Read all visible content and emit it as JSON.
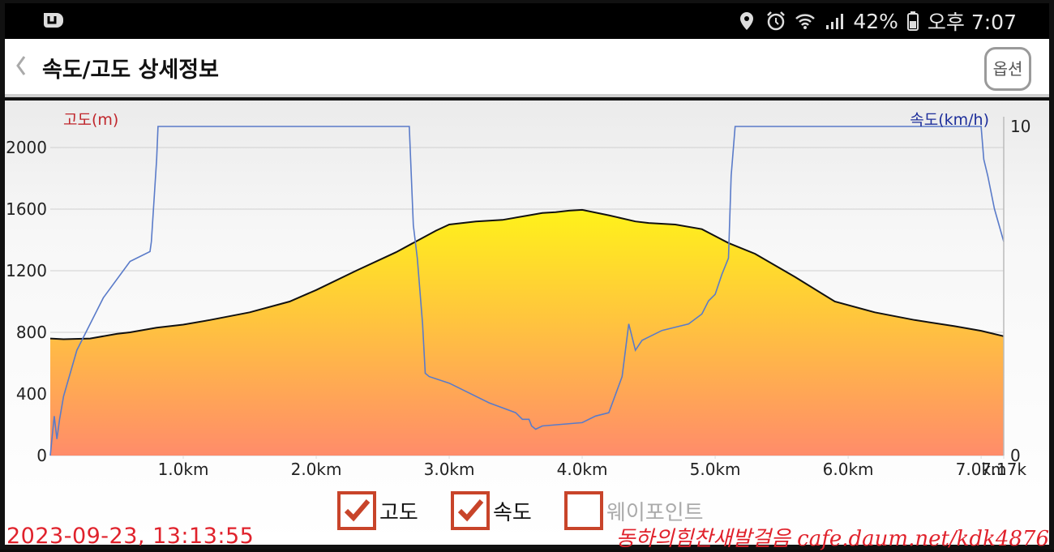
{
  "status_bar": {
    "battery": "42%",
    "time": "오후 7:07",
    "icons": [
      "location-icon",
      "alarm-icon",
      "wifi-icon",
      "signal-icon",
      "battery-icon"
    ]
  },
  "header": {
    "title": "속도/고도 상세정보",
    "options_label": "옵션"
  },
  "legend": {
    "altitude": "고도",
    "speed": "속도",
    "waypoint": "웨이포인트"
  },
  "footer": {
    "timestamp": "2023-09-23, 13:13:55",
    "watermark": "동하의힘찬새발걸음 cafe.daum.net/kdk4876"
  },
  "colors": {
    "altitude_line": "#111111",
    "speed_line": "#5a7bc9",
    "fill_top": "#fff21a",
    "fill_bottom": "#ff8c6a",
    "accent": "#c8442a"
  },
  "chart_data": {
    "type": "area",
    "left_axis_label": "고도(m)",
    "right_axis_label": "속도(km/h)",
    "x_ticks": [
      "1.0km",
      "2.0km",
      "3.0km",
      "4.0km",
      "5.0km",
      "6.0km",
      "7.0km",
      "7.17k"
    ],
    "y_ticks": [
      "0",
      "400",
      "800",
      "1200",
      "1600",
      "2000"
    ],
    "right_ticks": [
      "0",
      "10"
    ],
    "xlim": [
      0,
      7.17
    ],
    "ylim": [
      0,
      2200
    ],
    "y2lim": [
      0,
      10
    ],
    "series": [
      {
        "name": "고도",
        "axis": "left",
        "x": [
          0,
          0.1,
          0.3,
          0.5,
          0.6,
          0.8,
          1.0,
          1.2,
          1.5,
          1.8,
          2.0,
          2.3,
          2.6,
          2.9,
          3.0,
          3.2,
          3.4,
          3.6,
          3.7,
          3.8,
          3.9,
          4.0,
          4.2,
          4.4,
          4.5,
          4.7,
          4.9,
          5.1,
          5.3,
          5.6,
          5.9,
          6.2,
          6.5,
          6.8,
          7.0,
          7.17
        ],
        "y": [
          760,
          755,
          760,
          790,
          800,
          830,
          850,
          880,
          930,
          1000,
          1075,
          1200,
          1320,
          1460,
          1500,
          1520,
          1530,
          1560,
          1575,
          1580,
          1590,
          1595,
          1560,
          1520,
          1510,
          1500,
          1470,
          1380,
          1310,
          1160,
          1000,
          930,
          880,
          840,
          810,
          775
        ]
      },
      {
        "name": "속도",
        "axis": "right",
        "x": [
          0,
          0.03,
          0.05,
          0.07,
          0.1,
          0.2,
          0.4,
          0.6,
          0.75,
          0.76,
          0.8,
          0.81,
          2.7,
          2.73,
          2.76,
          2.8,
          2.82,
          2.85,
          3.0,
          3.3,
          3.5,
          3.55,
          3.6,
          3.62,
          3.65,
          3.7,
          4.0,
          4.1,
          4.2,
          4.3,
          4.35,
          4.4,
          4.45,
          4.5,
          4.6,
          4.8,
          4.9,
          4.95,
          5.0,
          5.05,
          5.1,
          5.12,
          5.15,
          7.0,
          7.02,
          7.05,
          7.1,
          7.17
        ],
        "y": [
          0,
          1.2,
          0.5,
          1.1,
          1.8,
          3.2,
          4.8,
          5.9,
          6.2,
          6.5,
          9.0,
          10.0,
          10.0,
          7.0,
          6.0,
          4.0,
          2.5,
          2.4,
          2.2,
          1.6,
          1.3,
          1.1,
          1.1,
          0.9,
          0.8,
          0.9,
          1.0,
          1.2,
          1.3,
          2.4,
          4.0,
          3.2,
          3.5,
          3.6,
          3.8,
          4.0,
          4.3,
          4.7,
          4.9,
          5.5,
          6.0,
          8.5,
          10.0,
          10.0,
          9.0,
          8.5,
          7.5,
          6.5
        ]
      }
    ]
  }
}
